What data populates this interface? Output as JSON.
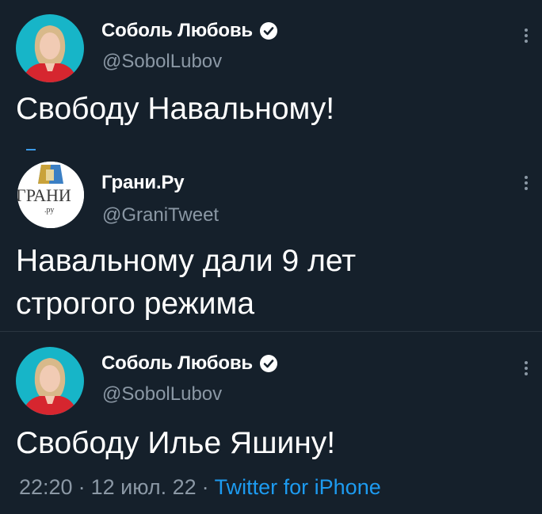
{
  "tweets": [
    {
      "display_name": "Соболь Любовь",
      "handle": "@SobolLubov",
      "text": "Свободу Навальному!",
      "verified": true,
      "avatar": "woman-portrait-avatar"
    },
    {
      "display_name": "Грани.Ру",
      "handle": "@GraniTweet",
      "text_lines": [
        "Навальному дали 9 лет",
        "строгого режима"
      ],
      "verified": false,
      "avatar": "grani-logo-avatar",
      "logo_text": "ГРАНИ",
      "logo_sub": ".ру"
    },
    {
      "display_name": "Соболь Любовь",
      "handle": "@SobolLubov",
      "text": "Свободу Илье Яшину!",
      "verified": true,
      "avatar": "woman-portrait-avatar"
    }
  ],
  "meta": {
    "time": "22:20",
    "separator": "·",
    "date": "12 июл. 22",
    "source": "Twitter for iPhone"
  },
  "colors": {
    "background": "#15202b",
    "secondary_text": "#8b98a5",
    "accent": "#1d9bf0",
    "avatar_bg": "#17b5c8",
    "avatar_shirt": "#d6262f"
  },
  "icons": {
    "verified": "verified-badge-icon",
    "more": "more-vertical-icon"
  }
}
